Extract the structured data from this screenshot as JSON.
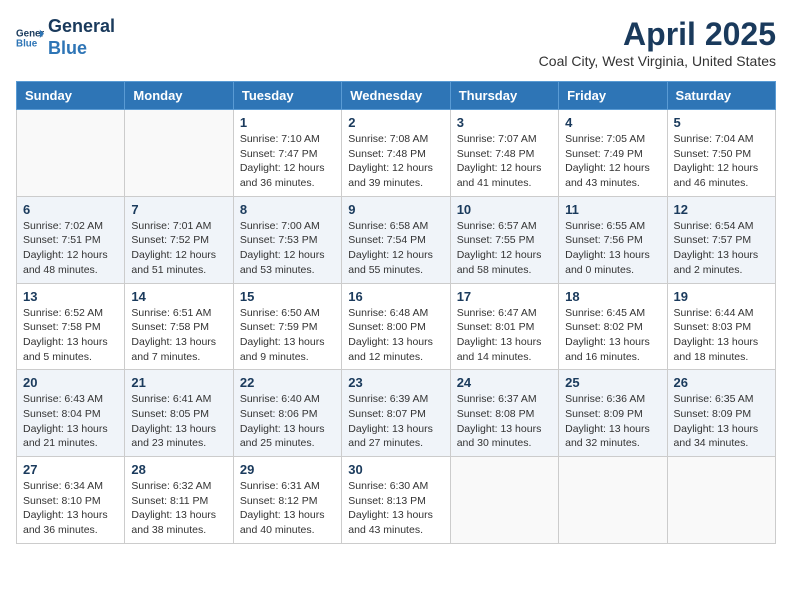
{
  "header": {
    "logo_line1": "General",
    "logo_line2": "Blue",
    "month": "April 2025",
    "location": "Coal City, West Virginia, United States"
  },
  "weekdays": [
    "Sunday",
    "Monday",
    "Tuesday",
    "Wednesday",
    "Thursday",
    "Friday",
    "Saturday"
  ],
  "rows": [
    [
      {
        "day": "",
        "info": ""
      },
      {
        "day": "",
        "info": ""
      },
      {
        "day": "1",
        "info": "Sunrise: 7:10 AM\nSunset: 7:47 PM\nDaylight: 12 hours\nand 36 minutes."
      },
      {
        "day": "2",
        "info": "Sunrise: 7:08 AM\nSunset: 7:48 PM\nDaylight: 12 hours\nand 39 minutes."
      },
      {
        "day": "3",
        "info": "Sunrise: 7:07 AM\nSunset: 7:48 PM\nDaylight: 12 hours\nand 41 minutes."
      },
      {
        "day": "4",
        "info": "Sunrise: 7:05 AM\nSunset: 7:49 PM\nDaylight: 12 hours\nand 43 minutes."
      },
      {
        "day": "5",
        "info": "Sunrise: 7:04 AM\nSunset: 7:50 PM\nDaylight: 12 hours\nand 46 minutes."
      }
    ],
    [
      {
        "day": "6",
        "info": "Sunrise: 7:02 AM\nSunset: 7:51 PM\nDaylight: 12 hours\nand 48 minutes."
      },
      {
        "day": "7",
        "info": "Sunrise: 7:01 AM\nSunset: 7:52 PM\nDaylight: 12 hours\nand 51 minutes."
      },
      {
        "day": "8",
        "info": "Sunrise: 7:00 AM\nSunset: 7:53 PM\nDaylight: 12 hours\nand 53 minutes."
      },
      {
        "day": "9",
        "info": "Sunrise: 6:58 AM\nSunset: 7:54 PM\nDaylight: 12 hours\nand 55 minutes."
      },
      {
        "day": "10",
        "info": "Sunrise: 6:57 AM\nSunset: 7:55 PM\nDaylight: 12 hours\nand 58 minutes."
      },
      {
        "day": "11",
        "info": "Sunrise: 6:55 AM\nSunset: 7:56 PM\nDaylight: 13 hours\nand 0 minutes."
      },
      {
        "day": "12",
        "info": "Sunrise: 6:54 AM\nSunset: 7:57 PM\nDaylight: 13 hours\nand 2 minutes."
      }
    ],
    [
      {
        "day": "13",
        "info": "Sunrise: 6:52 AM\nSunset: 7:58 PM\nDaylight: 13 hours\nand 5 minutes."
      },
      {
        "day": "14",
        "info": "Sunrise: 6:51 AM\nSunset: 7:58 PM\nDaylight: 13 hours\nand 7 minutes."
      },
      {
        "day": "15",
        "info": "Sunrise: 6:50 AM\nSunset: 7:59 PM\nDaylight: 13 hours\nand 9 minutes."
      },
      {
        "day": "16",
        "info": "Sunrise: 6:48 AM\nSunset: 8:00 PM\nDaylight: 13 hours\nand 12 minutes."
      },
      {
        "day": "17",
        "info": "Sunrise: 6:47 AM\nSunset: 8:01 PM\nDaylight: 13 hours\nand 14 minutes."
      },
      {
        "day": "18",
        "info": "Sunrise: 6:45 AM\nSunset: 8:02 PM\nDaylight: 13 hours\nand 16 minutes."
      },
      {
        "day": "19",
        "info": "Sunrise: 6:44 AM\nSunset: 8:03 PM\nDaylight: 13 hours\nand 18 minutes."
      }
    ],
    [
      {
        "day": "20",
        "info": "Sunrise: 6:43 AM\nSunset: 8:04 PM\nDaylight: 13 hours\nand 21 minutes."
      },
      {
        "day": "21",
        "info": "Sunrise: 6:41 AM\nSunset: 8:05 PM\nDaylight: 13 hours\nand 23 minutes."
      },
      {
        "day": "22",
        "info": "Sunrise: 6:40 AM\nSunset: 8:06 PM\nDaylight: 13 hours\nand 25 minutes."
      },
      {
        "day": "23",
        "info": "Sunrise: 6:39 AM\nSunset: 8:07 PM\nDaylight: 13 hours\nand 27 minutes."
      },
      {
        "day": "24",
        "info": "Sunrise: 6:37 AM\nSunset: 8:08 PM\nDaylight: 13 hours\nand 30 minutes."
      },
      {
        "day": "25",
        "info": "Sunrise: 6:36 AM\nSunset: 8:09 PM\nDaylight: 13 hours\nand 32 minutes."
      },
      {
        "day": "26",
        "info": "Sunrise: 6:35 AM\nSunset: 8:09 PM\nDaylight: 13 hours\nand 34 minutes."
      }
    ],
    [
      {
        "day": "27",
        "info": "Sunrise: 6:34 AM\nSunset: 8:10 PM\nDaylight: 13 hours\nand 36 minutes."
      },
      {
        "day": "28",
        "info": "Sunrise: 6:32 AM\nSunset: 8:11 PM\nDaylight: 13 hours\nand 38 minutes."
      },
      {
        "day": "29",
        "info": "Sunrise: 6:31 AM\nSunset: 8:12 PM\nDaylight: 13 hours\nand 40 minutes."
      },
      {
        "day": "30",
        "info": "Sunrise: 6:30 AM\nSunset: 8:13 PM\nDaylight: 13 hours\nand 43 minutes."
      },
      {
        "day": "",
        "info": ""
      },
      {
        "day": "",
        "info": ""
      },
      {
        "day": "",
        "info": ""
      }
    ]
  ]
}
